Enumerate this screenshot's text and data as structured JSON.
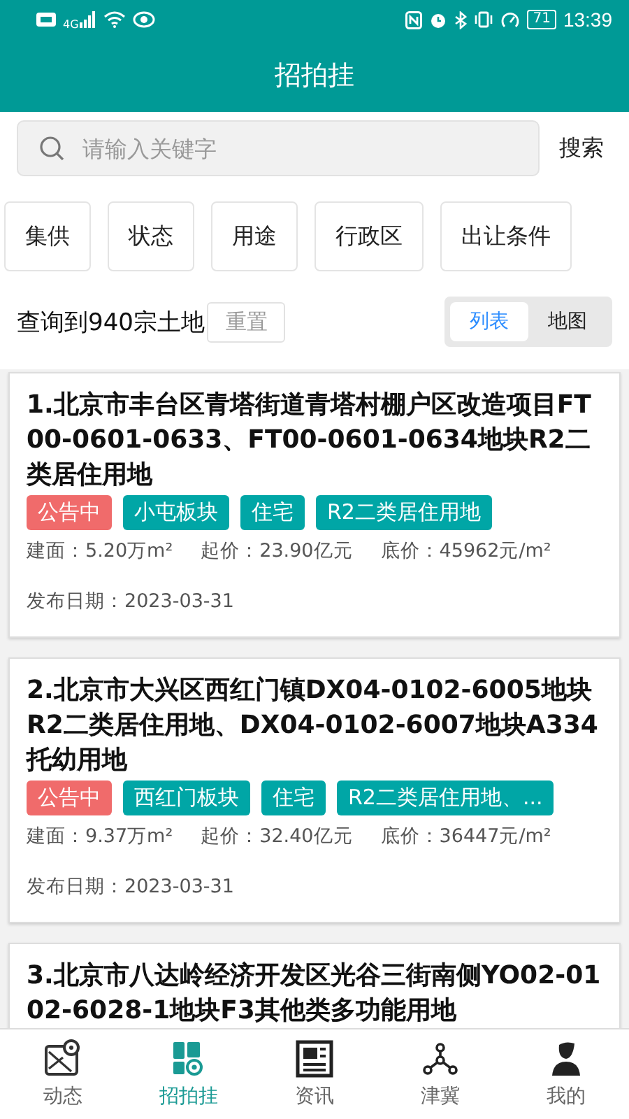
{
  "status_bar": {
    "network": "4G",
    "battery": "71",
    "time": "13:39"
  },
  "header": {
    "title": "招拍挂"
  },
  "search": {
    "placeholder": "请输入关键字",
    "button": "搜索"
  },
  "filters": [
    "集供",
    "状态",
    "用途",
    "行政区",
    "出让条件"
  ],
  "summary": {
    "count_text": "查询到940宗土地",
    "reset": "重置"
  },
  "view_tabs": [
    {
      "label": "列表",
      "selected": true
    },
    {
      "label": "地图",
      "selected": false
    }
  ],
  "listings": [
    {
      "title": "1.北京市丰台区青塔街道青塔村棚户区改造项目FT00-0601-0633、FT00-0601-0634地块R2二类居住用地",
      "tags": [
        {
          "label": "公告中",
          "color": "#f06b6b"
        },
        {
          "label": "小屯板块",
          "color": "#00a6a6"
        },
        {
          "label": "住宅",
          "color": "#00a6a6"
        },
        {
          "label": "R2二类居住用地",
          "color": "#00a6a6"
        }
      ],
      "stats": [
        "建面：5.20万m²",
        "起价：23.90亿元",
        "底价：45962元/m²"
      ],
      "date": "发布日期：2023-03-31"
    },
    {
      "title": "2.北京市大兴区西红门镇DX04-0102-6005地块R2二类居住用地、DX04-0102-6007地块A334托幼用地",
      "tags": [
        {
          "label": "公告中",
          "color": "#f06b6b"
        },
        {
          "label": "西红门板块",
          "color": "#00a6a6"
        },
        {
          "label": "住宅",
          "color": "#00a6a6"
        },
        {
          "label": "R2二类居住用地、...",
          "color": "#00a6a6"
        }
      ],
      "stats": [
        "建面：9.37万m²",
        "起价：32.40亿元",
        "底价：36447元/m²"
      ],
      "date": "发布日期：2023-03-31"
    },
    {
      "title": "3.北京市八达岭经济开发区光谷三街南侧YO02-0102-6028-1地块F3其他类多功能用地"
    }
  ],
  "nav": [
    {
      "kind": "map",
      "label": "动态",
      "selected": false
    },
    {
      "kind": "auction",
      "label": "招拍挂",
      "selected": true
    },
    {
      "kind": "news",
      "label": "资讯",
      "selected": false
    },
    {
      "kind": "network",
      "label": "津冀",
      "selected": false
    },
    {
      "kind": "user",
      "label": "我的",
      "selected": false
    }
  ]
}
